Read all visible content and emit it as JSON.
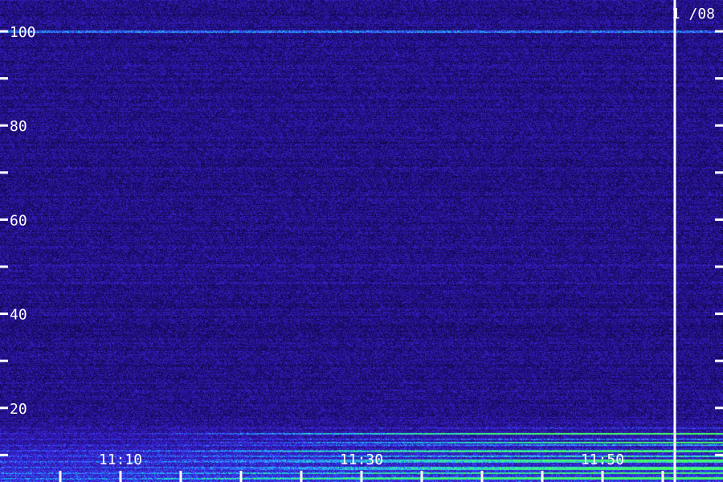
{
  "chart_data": {
    "type": "heatmap",
    "title": "",
    "xlabel": "",
    "ylabel": "",
    "date_label": "1 /08",
    "y_ticks": [
      {
        "value": 100,
        "label": "100"
      },
      {
        "value": 90,
        "label": ""
      },
      {
        "value": 80,
        "label": "80"
      },
      {
        "value": 70,
        "label": ""
      },
      {
        "value": 60,
        "label": "60"
      },
      {
        "value": 50,
        "label": ""
      },
      {
        "value": 40,
        "label": "40"
      },
      {
        "value": 30,
        "label": ""
      },
      {
        "value": 20,
        "label": "20"
      },
      {
        "value": 10,
        "label": ""
      }
    ],
    "x_ticks": [
      {
        "value": "11:05",
        "label": ""
      },
      {
        "value": "11:10",
        "label": "11:10"
      },
      {
        "value": "11:15",
        "label": ""
      },
      {
        "value": "11:20",
        "label": ""
      },
      {
        "value": "11:25",
        "label": ""
      },
      {
        "value": "11:30",
        "label": "11:30"
      },
      {
        "value": "11:35",
        "label": ""
      },
      {
        "value": "11:40",
        "label": ""
      },
      {
        "value": "11:45",
        "label": ""
      },
      {
        "value": "11:50",
        "label": "11:50"
      },
      {
        "value": "11:55",
        "label": ""
      }
    ],
    "xlim": [
      "11:00",
      "12:00"
    ],
    "ylim": [
      0,
      110
    ],
    "marker_time": "11:56",
    "grid": false,
    "colors": {
      "background": "#1a0c52",
      "low": "#0a0420",
      "mid": "#3a1fd0",
      "high": "#2f7bff",
      "peak": "#3cff6a",
      "marker": "#ffffff",
      "text": "#ffffff"
    }
  }
}
